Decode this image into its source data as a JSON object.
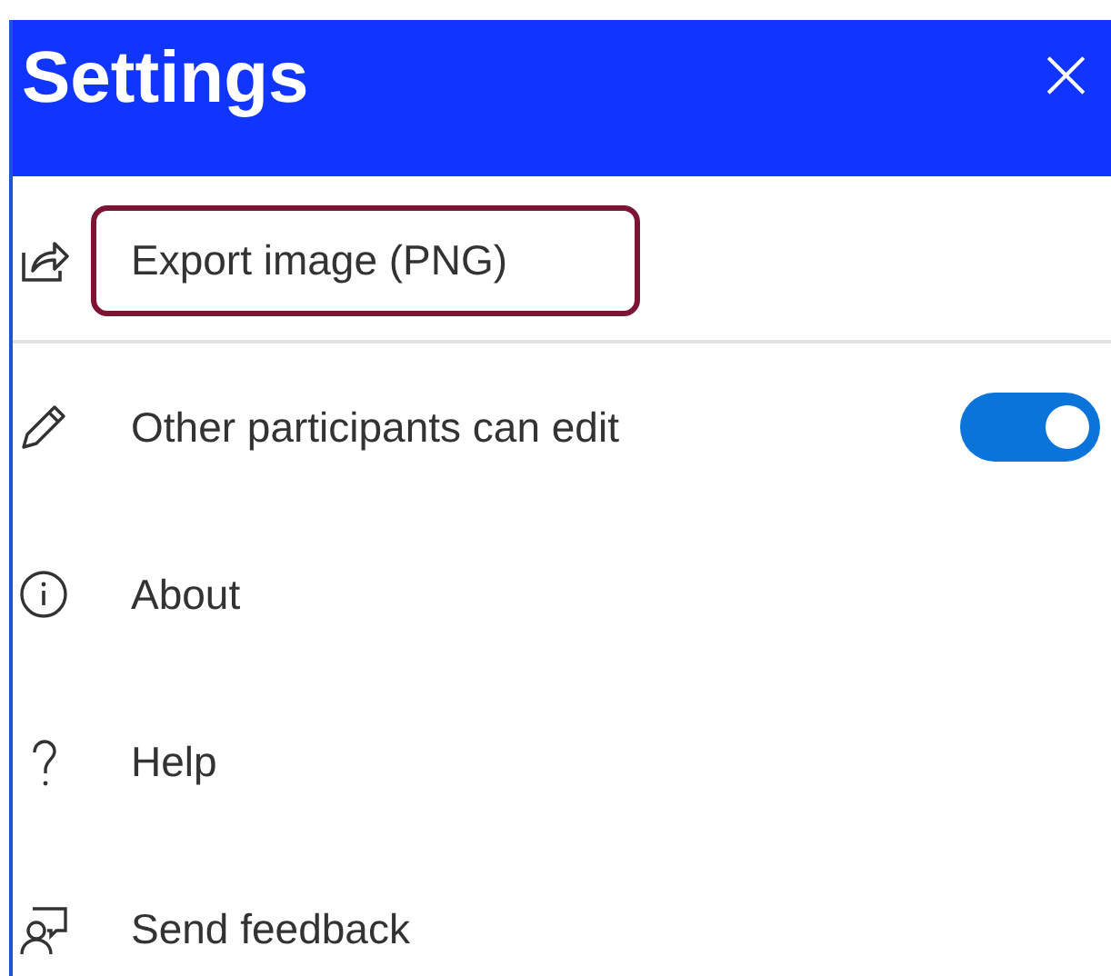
{
  "panel": {
    "title": "Settings",
    "close_label": "×"
  },
  "items": [
    {
      "kind": "action",
      "label": "Export image (PNG)",
      "highlighted": true,
      "divider_after": true
    },
    {
      "kind": "toggle",
      "label": "Other participants can edit",
      "on": true
    },
    {
      "kind": "action",
      "label": "About",
      "highlighted": false
    },
    {
      "kind": "action",
      "label": "Help",
      "highlighted": false
    },
    {
      "kind": "action",
      "label": "Send feedback",
      "highlighted": false
    }
  ]
}
